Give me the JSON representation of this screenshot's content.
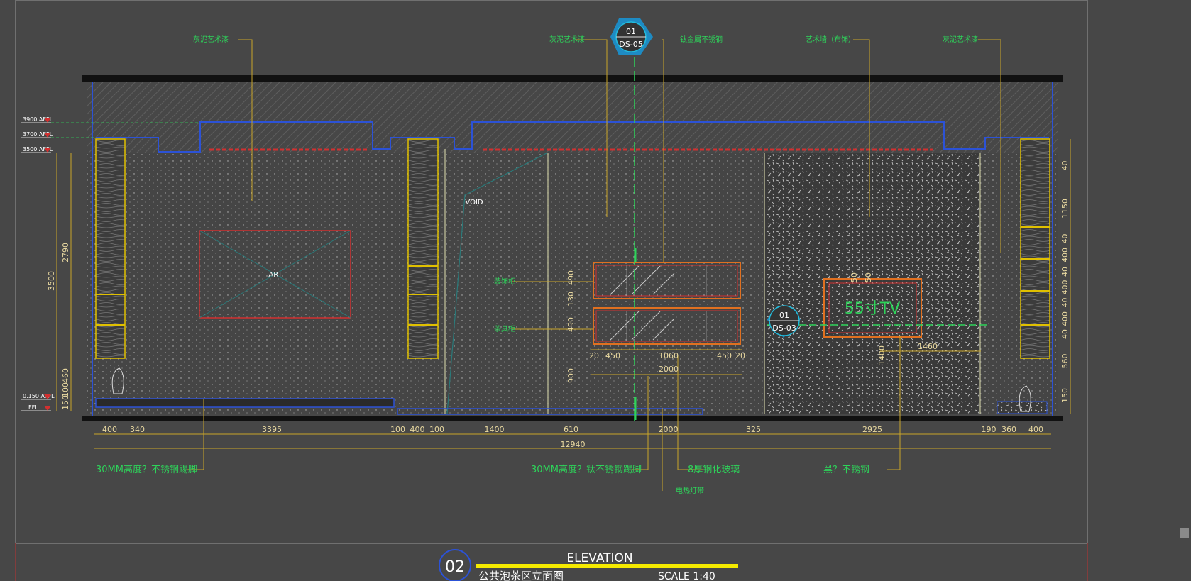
{
  "drawing": {
    "title_en": "ELEVATION",
    "title_cn": "公共泡茶区立面图",
    "scale": "SCALE 1:40",
    "number": "02"
  },
  "callouts": {
    "top": [
      "灰泥艺术漆",
      "灰泥艺术漆",
      "钛金属不锈钢",
      "艺术墙（布饰）",
      "灰泥艺术漆"
    ],
    "bottom": [
      "30MM高度？不锈钢踢脚",
      "30MM高度？钛不锈钢踢脚",
      "8厚钢化玻璃",
      "黑？不锈钢"
    ],
    "bottom_extra": "电热灯带",
    "mid_left_1": "装饰柜",
    "mid_left_2": "茶具柜"
  },
  "labels": {
    "art": "ART",
    "void": "VOID",
    "tv": "55寸TV",
    "section_a_num": "01",
    "section_a_ref": "DS-05",
    "section_b_num": "01",
    "section_b_ref": "DS-03"
  },
  "levels": [
    "3900 AFFL",
    "3700 AFFL",
    "3500 AFFL",
    "0.150 AFFL",
    "FFL"
  ],
  "left_dims": [
    "3500",
    "2790",
    "460",
    "100",
    "150"
  ],
  "right_dims": [
    "40",
    "1150",
    "40",
    "400",
    "40",
    "400",
    "40",
    "400",
    "40",
    "560",
    "150"
  ],
  "bottom_dims": [
    "400",
    "340",
    "3395",
    "100",
    "400",
    "100",
    "1400",
    "610",
    "2000",
    "325",
    "2925",
    "190",
    "360",
    "400"
  ],
  "total_dim": "12940",
  "cabinet_dims": [
    "490",
    "130",
    "490",
    "900",
    "20",
    "450",
    "1060",
    "450",
    "20",
    "2000"
  ],
  "tv_dims": [
    "50",
    "50",
    "1460",
    "1400"
  ]
}
